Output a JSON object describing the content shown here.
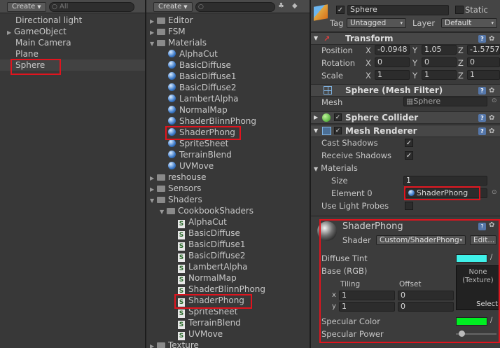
{
  "hierarchy": {
    "create_label": "Create",
    "search_placeholder": "All",
    "items": [
      "Directional light",
      "GameObject",
      "Main Camera",
      "Plane",
      "Sphere"
    ]
  },
  "project": {
    "create_label": "Create",
    "items": [
      "Editor",
      "FSM",
      "Materials",
      "AlphaCut",
      "BasicDiffuse",
      "BasicDiffuse1",
      "BasicDiffuse2",
      "LambertAlpha",
      "NormalMap",
      "ShaderBlinnPhong",
      "ShaderPhong",
      "SpriteSheet",
      "TerrainBlend",
      "UVMove",
      "reshouse",
      "Sensors",
      "Shaders",
      "CookbookShaders",
      "AlphaCut",
      "BasicDiffuse",
      "BasicDiffuse1",
      "BasicDiffuse2",
      "LambertAlpha",
      "NormalMap",
      "ShaderBlinnPhong",
      "ShaderPhong",
      "SpriteSheet",
      "TerrainBlend",
      "UVMove",
      "Texture"
    ]
  },
  "inspector": {
    "object_name": "Sphere",
    "static_label": "Static",
    "tag_label": "Tag",
    "tag_value": "Untagged",
    "layer_label": "Layer",
    "layer_value": "Default",
    "transform": {
      "title": "Transform",
      "position_label": "Position",
      "rotation_label": "Rotation",
      "scale_label": "Scale",
      "x": "X",
      "y": "Y",
      "z": "Z",
      "position": [
        "-0.0948",
        "1.05",
        "-1.5757"
      ],
      "rotation": [
        "0",
        "0",
        "0"
      ],
      "scale": [
        "1",
        "1",
        "1"
      ]
    },
    "mesh_filter": {
      "title": "Sphere (Mesh Filter)",
      "mesh_label": "Mesh",
      "mesh_value": "Sphere"
    },
    "sphere_collider": {
      "title": "Sphere Collider"
    },
    "mesh_renderer": {
      "title": "Mesh Renderer",
      "cast_shadows_label": "Cast Shadows",
      "receive_shadows_label": "Receive Shadows",
      "materials_label": "Materials",
      "size_label": "Size",
      "size_value": "1",
      "element0_label": "Element 0",
      "element0_value": "ShaderPhong",
      "light_probes_label": "Use Light Probes"
    },
    "material": {
      "name": "ShaderPhong",
      "shader_label": "Shader",
      "shader_value": "Custom/ShaderPhong",
      "edit_label": "Edit...",
      "diffuse_tint_label": "Diffuse Tint",
      "base_label": "Base (RGB)",
      "tiling_label": "Tiling",
      "offset_label": "Offset",
      "x_label": "x",
      "y_label": "y",
      "tiling": [
        "1",
        "1"
      ],
      "offset": [
        "0",
        "0"
      ],
      "texture_none": "None",
      "texture_type": "(Texture)",
      "select_label": "Select",
      "specular_color_label": "Specular Color",
      "specular_power_label": "Specular Power"
    }
  },
  "colors": {
    "highlight": "#e0141e",
    "diffuse_tint": "#3ff1e9",
    "specular_color": "#00ee22"
  }
}
